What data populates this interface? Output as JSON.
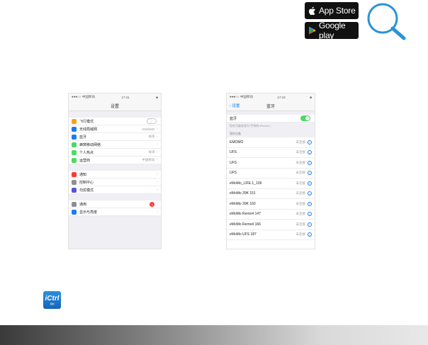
{
  "store_badges": {
    "app_store": "App Store",
    "google_play": "Google play"
  },
  "settings_screen": {
    "status": {
      "carrier": "●●●○○ 中国移动",
      "time": "17:41",
      "battery": "■"
    },
    "title": "设置",
    "groups": [
      [
        {
          "label": "飞行模式",
          "value": "",
          "control": "toggle-off",
          "icon_color": "#f7a21b"
        },
        {
          "label": "无线局域网",
          "value": "EMOMO",
          "icon_color": "#1a7cf5"
        },
        {
          "label": "蓝牙",
          "value": "关闭",
          "icon_color": "#1a7cf5"
        },
        {
          "label": "蜂窝移动网络",
          "value": "",
          "icon_color": "#4cd964"
        },
        {
          "label": "个人热点",
          "value": "关闭",
          "icon_color": "#4cd964"
        },
        {
          "label": "运营商",
          "value": "中国移动",
          "icon_color": "#4cd964"
        }
      ],
      [
        {
          "label": "通知",
          "value": "",
          "icon_color": "#ff3b30"
        },
        {
          "label": "控制中心",
          "value": "",
          "icon_color": "#8e8e93"
        },
        {
          "label": "勿扰模式",
          "value": "",
          "icon_color": "#5856d6"
        }
      ],
      [
        {
          "label": "通用",
          "value": "",
          "badge": "1",
          "icon_color": "#8e8e93"
        },
        {
          "label": "显示与亮度",
          "value": "",
          "icon_color": "#1a7cf5"
        }
      ]
    ]
  },
  "bluetooth_screen": {
    "status": {
      "carrier": "●●●○○ 中国移动",
      "time": "17:43",
      "battery": "■"
    },
    "back_label": "设置",
    "title": "蓝牙",
    "toggle_label": "蓝牙",
    "toggle_on": true,
    "note": "现在可被发现为\"手机的 iPhone\"。",
    "section_header": "我的设备",
    "status_text": "未连接",
    "devices": [
      "EMOMO",
      "UFS",
      "UFS",
      "UFS",
      "eMoMo_LIFE.1_109",
      "eMoMo 39K 151",
      "eMoMo 39K 160",
      "eMoMo Remo4 147",
      "eMoMo Remo4 166",
      "eMoMo UFS 187"
    ]
  },
  "app_icon": {
    "name": "iCtrl",
    "sub": "控制"
  },
  "colors": {
    "ios_blue": "#1a7cf5",
    "toggle_green": "#4cd964",
    "magnifier": "#2a93d5"
  }
}
